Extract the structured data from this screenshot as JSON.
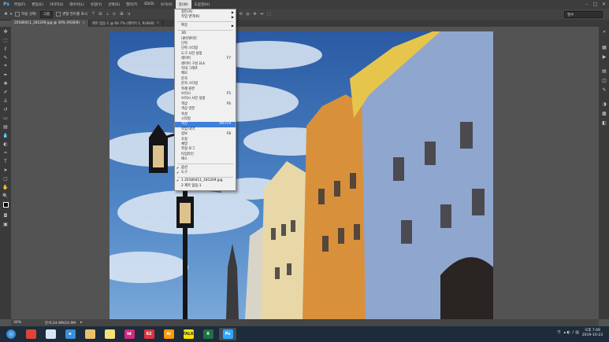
{
  "app": {
    "logo": "Ps"
  },
  "menubar": {
    "items": [
      "파일(F)",
      "편집(E)",
      "이미지(I)",
      "레이어(L)",
      "유형(Y)",
      "선택(S)",
      "필터(T)",
      "3D(D)",
      "보기(V)",
      "창(W)",
      "도움말(H)"
    ],
    "active_index": 9
  },
  "window_controls": {
    "minimize": "–",
    "maximize": "□",
    "close": "✕"
  },
  "options_bar": {
    "auto_select_label": "자동 선택:",
    "auto_select_value": "그룹",
    "show_transform_label": "변형 컨트롤 표시",
    "workspace_value": "필수"
  },
  "tabs": [
    {
      "label": "20180411_181209.jpg @ 30% (RGB/8)",
      "close": "×"
    },
    {
      "label": "제목 없음-1 @ 66.7% (레이어 1, RGB/8)",
      "close": "×"
    }
  ],
  "status_bar": {
    "zoom": "30%",
    "doc_info": "문서:24.9M/24.9M"
  },
  "taskbar": {
    "apps": [
      {
        "name": "chrome",
        "label": "",
        "color": "#dc4437"
      },
      {
        "name": "explorer-window",
        "label": "",
        "color": "#d7e6f5"
      },
      {
        "name": "ie",
        "label": "e",
        "color": "#3a8fdc"
      },
      {
        "name": "folder",
        "label": "",
        "color": "#e8c26a"
      },
      {
        "name": "notes",
        "label": "",
        "color": "#f3e27a"
      },
      {
        "name": "indesign",
        "label": "Id",
        "color": "#d4287f"
      },
      {
        "name": "app-82",
        "label": "82",
        "color": "#e0323c"
      },
      {
        "name": "illustrator",
        "label": "Ai",
        "color": "#ff9a00"
      },
      {
        "name": "kakaotalk",
        "label": "TALK",
        "color": "#f7e300"
      },
      {
        "name": "excel",
        "label": "X",
        "color": "#1e7145"
      },
      {
        "name": "photoshop",
        "label": "Ps",
        "color": "#31a8ff"
      }
    ],
    "tray_text": "가",
    "clock_time": "오후 7:49",
    "clock_date": "2019-10-23"
  },
  "window_menu": {
    "items": [
      {
        "label": "정돈(A)",
        "submenu": true
      },
      {
        "label": "작업 영역(K)",
        "submenu": true
      },
      {
        "sep": true
      },
      {
        "label": "확장",
        "submenu": true
      },
      {
        "sep": true
      },
      {
        "label": "3D"
      },
      {
        "label": "내비게이터"
      },
      {
        "label": "단락"
      },
      {
        "label": "단락 스타일"
      },
      {
        "label": "도구 사전 설정"
      },
      {
        "label": "레이어",
        "shortcut": "F7"
      },
      {
        "label": "레이어 구성 요소"
      },
      {
        "label": "막대 그래프"
      },
      {
        "label": "메모"
      },
      {
        "label": "문자"
      },
      {
        "label": "문자 스타일"
      },
      {
        "label": "복제 원본"
      },
      {
        "label": "브러시",
        "shortcut": "F5"
      },
      {
        "label": "브러시 사전 설정"
      },
      {
        "label": "색상",
        "shortcut": "F6"
      },
      {
        "label": "색상 견본"
      },
      {
        "label": "속성"
      },
      {
        "label": "스타일"
      },
      {
        "label": "액션",
        "shortcut": "Alt+F9",
        "highlighted": true
      },
      {
        "label": "작업 내역"
      },
      {
        "label": "정보",
        "shortcut": "F8"
      },
      {
        "label": "조정"
      },
      {
        "label": "채널"
      },
      {
        "label": "측정 로그"
      },
      {
        "label": "타임라인"
      },
      {
        "label": "패스"
      },
      {
        "sep": true
      },
      {
        "label": "옵션",
        "checked": true
      },
      {
        "label": "도구",
        "checked": true
      },
      {
        "sep": true
      },
      {
        "label": "1 20180411_181209.jpg",
        "checked": true
      },
      {
        "label": "2 제목 없음-1"
      }
    ]
  }
}
